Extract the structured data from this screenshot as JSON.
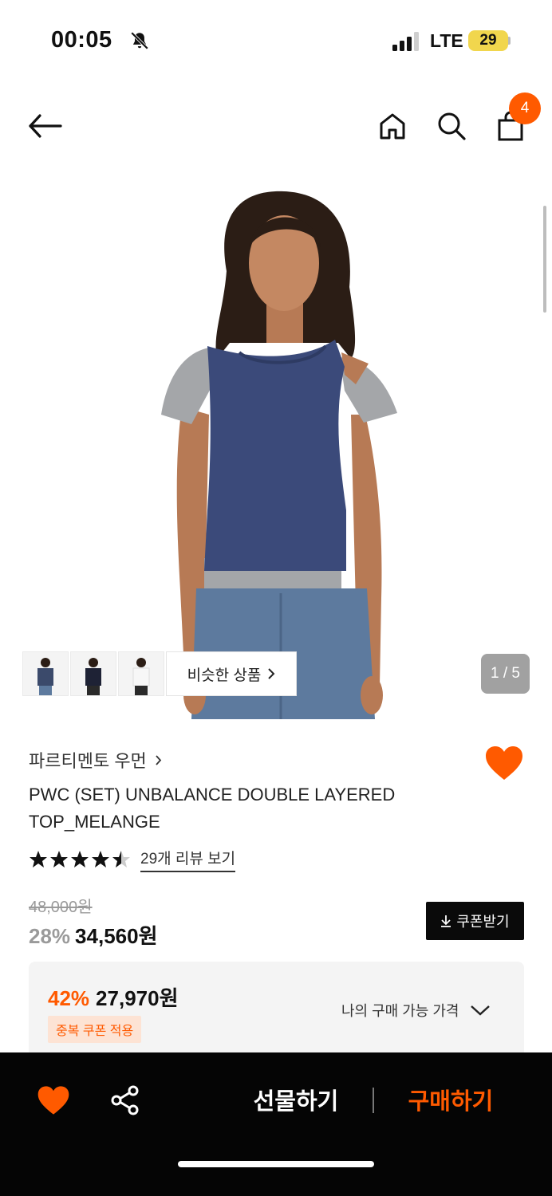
{
  "status_bar": {
    "time": "00:05",
    "network": "LTE",
    "battery": "29"
  },
  "header": {
    "cart_count": "4",
    "icons": [
      "back-arrow-icon",
      "home-icon",
      "search-icon",
      "bag-icon"
    ]
  },
  "gallery": {
    "similar_label": "비슷한 상품",
    "page_indicator": "1 / 5",
    "thumb_colors": [
      "#3b4a6b",
      "#1e2235",
      "#ffffff"
    ],
    "scroll_fraction": 0.2
  },
  "product": {
    "brand": "파르티멘토 우먼",
    "title": "PWC (SET) UNBALANCE DOUBLE LAYERED TOP_MELANGE",
    "rating": 4.5,
    "review_link": "29개 리뷰 보기",
    "original_price": "48,000원",
    "discount_rate": "28%",
    "sale_price": "34,560원",
    "coupon_label": "쿠폰받기"
  },
  "best_price": {
    "rate": "42%",
    "price": "27,970원",
    "tag": "중복 쿠폰 적용",
    "toggle_label": "나의 구매 가능 가격"
  },
  "bottom_bar": {
    "gift_label": "선물하기",
    "buy_label": "구매하기"
  },
  "colors": {
    "accent": "#ff5a00",
    "bottom_bar": "#050505",
    "battery": "#f1d64d"
  }
}
